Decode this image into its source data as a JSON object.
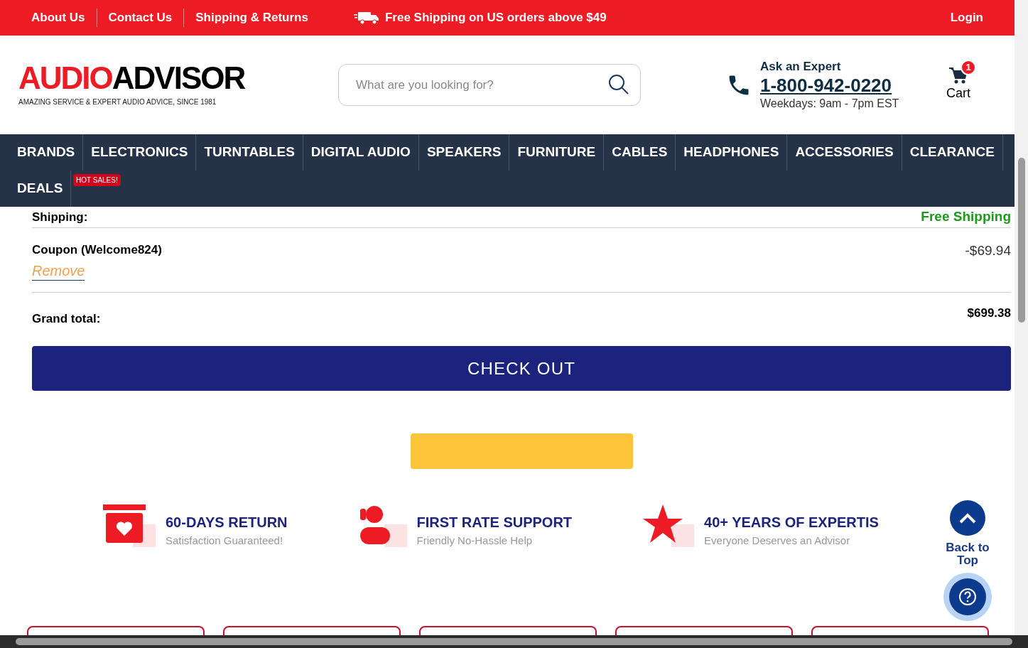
{
  "top_bar": {
    "links": [
      "About Us",
      "Contact Us",
      "Shipping & Returns"
    ],
    "promo": "Free Shipping on US orders above $49",
    "login": "Login"
  },
  "header": {
    "logo": {
      "red": "AUDIO",
      "black": "ADVISOR",
      "tagline": "AMAZING SERVICE & EXPERT AUDIO ADVICE, SINCE 1981"
    },
    "search": {
      "placeholder": "What are you looking for?"
    },
    "contact": {
      "title": "Ask an Expert",
      "phone": "1-800-942-0220",
      "hours": "Weekdays: 9am - 7pm EST"
    },
    "cart": {
      "label": "Cart",
      "count": "1"
    }
  },
  "nav": {
    "items": [
      {
        "label": "BRANDS"
      },
      {
        "label": "ELECTRONICS"
      },
      {
        "label": "TURNTABLES"
      },
      {
        "label": "DIGITAL AUDIO"
      },
      {
        "label": "SPEAKERS"
      },
      {
        "label": "FURNITURE"
      },
      {
        "label": "CABLES"
      },
      {
        "label": "HEADPHONES"
      },
      {
        "label": "ACCESSORIES"
      },
      {
        "label": "CLEARANCE"
      },
      {
        "label": "DEALS",
        "badge": "HOT SALES!"
      }
    ]
  },
  "summary": {
    "shipping": {
      "label": "Shipping:",
      "value": "Free Shipping"
    },
    "coupon": {
      "label": "Coupon (Welcome824)",
      "remove": "Remove",
      "value": "-$69.94"
    },
    "grand_total": {
      "label": "Grand total:",
      "value": "$699.38"
    },
    "checkout": "CHECK OUT"
  },
  "features": [
    {
      "kind": "return",
      "title": "60-DAYS RETURN",
      "subtitle": "Satisfaction Guaranteed!"
    },
    {
      "kind": "support",
      "title": "FIRST RATE SUPPORT",
      "subtitle": "Friendly No-Hassle Help"
    },
    {
      "kind": "star",
      "title": "40+ YEARS OF EXPERTIS",
      "subtitle": "Everyone Deserves an Advisor"
    }
  ],
  "back_to_top": "Back to Top"
}
